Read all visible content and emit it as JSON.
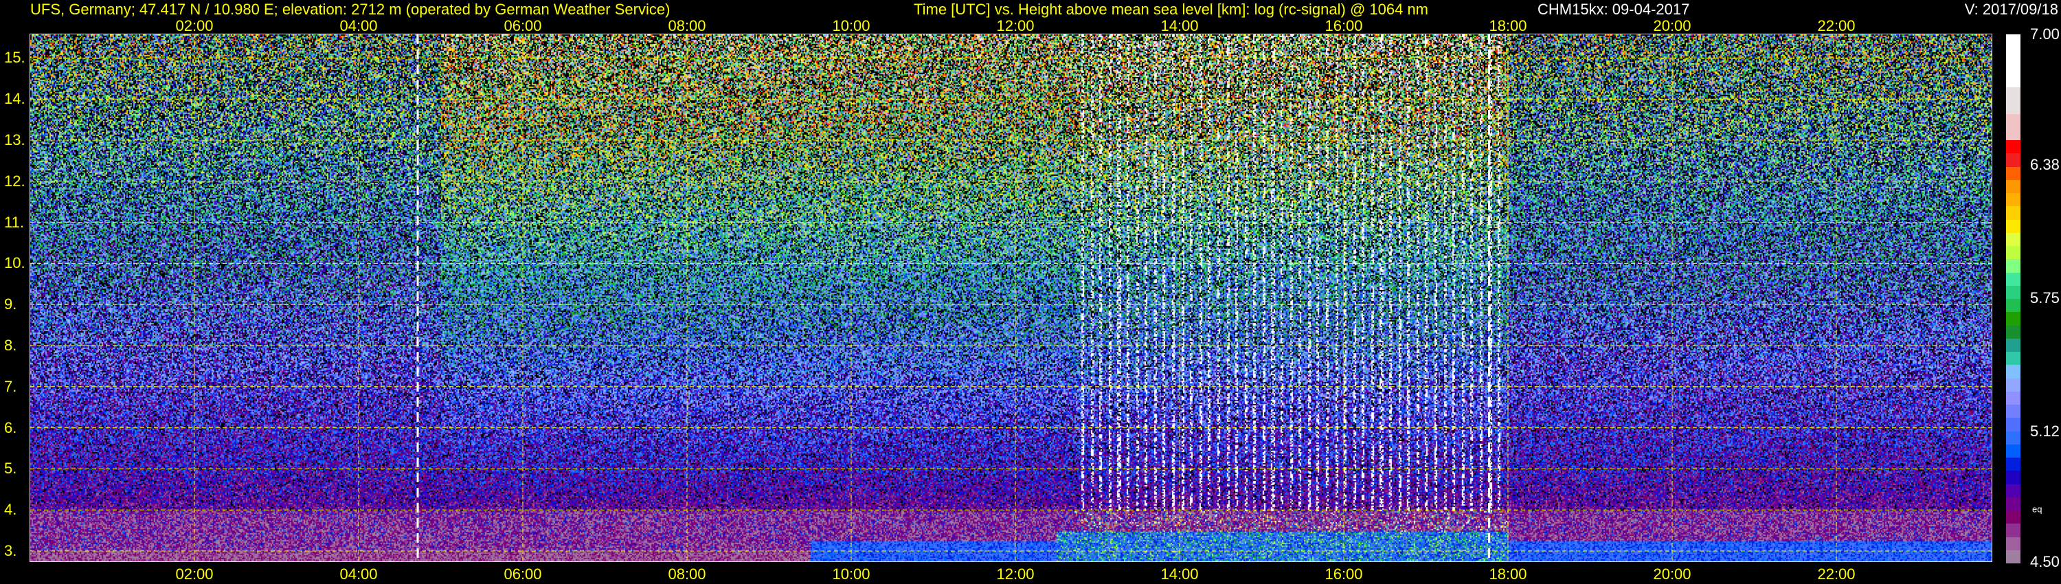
{
  "header": {
    "station": "UFS, Germany; 47.417 N / 10.980 E; elevation: 2712 m  (operated by German Weather Service)",
    "plot_title": "Time [UTC] vs. Height above mean sea level [km]: log (rc-signal) @ 1064 nm",
    "instrument": "CHM15kx: 09-04-2017",
    "version": "V: 2017/09/18"
  },
  "chart_data": {
    "type": "heatmap",
    "title": "Time [UTC] vs. Height above mean sea level [km]: log (rc-signal) @ 1064 nm",
    "xlabel": "Time [UTC]",
    "ylabel": "Height above mean sea level [km]",
    "xlim_hours": [
      0,
      24
    ],
    "ylim_km": [
      2.75,
      15.57
    ],
    "x_ticks": [
      {
        "h": 2,
        "label": "02:00"
      },
      {
        "h": 4,
        "label": "04:00"
      },
      {
        "h": 6,
        "label": "06:00"
      },
      {
        "h": 8,
        "label": "08:00"
      },
      {
        "h": 10,
        "label": "10:00"
      },
      {
        "h": 12,
        "label": "12:00"
      },
      {
        "h": 14,
        "label": "14:00"
      },
      {
        "h": 16,
        "label": "16:00"
      },
      {
        "h": 18,
        "label": "18:00"
      },
      {
        "h": 20,
        "label": "20:00"
      },
      {
        "h": 22,
        "label": "22:00"
      }
    ],
    "y_ticks": [
      {
        "km": 3,
        "label": "3."
      },
      {
        "km": 4,
        "label": "4."
      },
      {
        "km": 5,
        "label": "5."
      },
      {
        "km": 6,
        "label": "6."
      },
      {
        "km": 7,
        "label": "7."
      },
      {
        "km": 8,
        "label": "8."
      },
      {
        "km": 9,
        "label": "9."
      },
      {
        "km": 10,
        "label": "10."
      },
      {
        "km": 11,
        "label": "11."
      },
      {
        "km": 12,
        "label": "12."
      },
      {
        "km": 13,
        "label": "13."
      },
      {
        "km": 14,
        "label": "14."
      },
      {
        "km": 15,
        "label": "15."
      }
    ],
    "grid": true,
    "markers_hours": [
      4.72,
      17.77
    ],
    "colorbar": {
      "range": [
        4.5,
        7.0
      ],
      "ticks": [
        {
          "v": 7.0,
          "label": "7.00"
        },
        {
          "v": 6.38,
          "label": "6.38"
        },
        {
          "v": 5.75,
          "label": "5.75"
        },
        {
          "v": 5.12,
          "label": "5.12"
        },
        {
          "v": 4.5,
          "label": "4.50"
        }
      ],
      "unit_label": "eq",
      "colors_top_to_bottom": [
        "#ffffff",
        "#ffffff",
        "#ffffff",
        "#ffffff",
        "#e8e0e0",
        "#e8e0e0",
        "#f0c4c4",
        "#f0c4c4",
        "#ff0000",
        "#f02020",
        "#ff6000",
        "#ff9800",
        "#ffb000",
        "#ffd000",
        "#ffe800",
        "#e0ff40",
        "#c0ff40",
        "#80ff80",
        "#40e8a0",
        "#28d080",
        "#20c050",
        "#20a000",
        "#189030",
        "#20a090",
        "#30c8a8",
        "#80c0ff",
        "#90a8ff",
        "#9090ff",
        "#7080ff",
        "#5070ff",
        "#3070ff",
        "#0060ff",
        "#0020e0",
        "#2000c0",
        "#5000b0",
        "#700090",
        "#800070",
        "#903090",
        "#a060a0",
        "#a080a0"
      ]
    }
  }
}
